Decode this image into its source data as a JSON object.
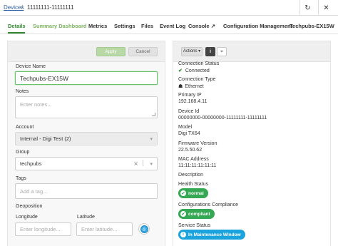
{
  "breadcrumb": {
    "root": "Devices",
    "separator": "/",
    "current": "11111111-11111111"
  },
  "topbar": {
    "refresh_icon": "refresh-icon",
    "close_icon": "close-icon"
  },
  "tabs": [
    {
      "label": "Details"
    },
    {
      "label": "Summary Dashboard"
    },
    {
      "label": "Metrics"
    },
    {
      "label": "Settings"
    },
    {
      "label": "Files"
    },
    {
      "label": "Event Log"
    },
    {
      "label": "Console"
    },
    {
      "label": "Configuration Management"
    },
    {
      "label": "Techpubs-EX15W"
    }
  ],
  "form": {
    "apply_label": "Apply",
    "cancel_label": "Cancel",
    "device_name_label": "Device Name",
    "device_name_value": "Techpubs-EX15W",
    "notes_label": "Notes",
    "notes_placeholder": "Enter notes...",
    "account_label": "Account",
    "account_value": "Internal - Digi Test (2)",
    "group_label": "Group",
    "group_value": "techpubs",
    "tags_label": "Tags",
    "tags_placeholder": "Add a tag...",
    "geoposition_label": "Geoposition",
    "longitude_label": "Longitude",
    "longitude_placeholder": "Enter longitude...",
    "latitude_label": "Latitude",
    "latitude_placeholder": "Enter latitude..."
  },
  "details": {
    "actions_label": "Actions",
    "info_label": "i",
    "connection_status_label": "Connection Status",
    "connection_status_value": "Connected",
    "connection_type_label": "Connection Type",
    "connection_type_value": "Ethernet",
    "primary_ip_label": "Primary IP",
    "primary_ip_value": "192.168.4.11",
    "device_id_label": "Device Id",
    "device_id_value": "00000000-00000000-11111111-11111111",
    "model_label": "Model",
    "model_value": "Digi TX64",
    "firmware_label": "Firmware Version",
    "firmware_value": "22.5.50.62",
    "mac_label": "MAC Address",
    "mac_value": "11:11:11:11:11:11",
    "description_label": "Description",
    "health_label": "Health Status",
    "health_value": "normal",
    "compliance_label": "Configurations Compliance",
    "compliance_value": "compliant",
    "service_label": "Service Status",
    "service_value": "In Maintenance Window"
  },
  "colors": {
    "accent_green": "#2f8a2f",
    "status_green": "#34a853",
    "status_blue": "#1aa3dd",
    "link_blue": "#2a5d9f"
  }
}
